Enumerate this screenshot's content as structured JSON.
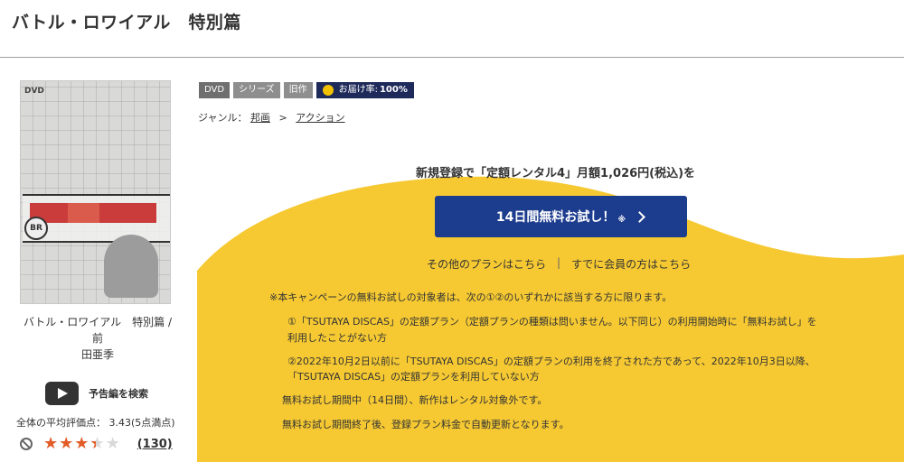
{
  "page": {
    "title": "バトル・ロワイアル　特別篇"
  },
  "item": {
    "cover_alt": "バトル・ロワイアル 特別篇 DVDジャケット",
    "caption_line1": "バトル・ロワイアル　特別篇 / 前",
    "caption_line2": "田亜季",
    "cover_mark": "DVD",
    "cover_badge": "BR"
  },
  "trailer": {
    "label": "予告編を検索",
    "icon": "youtube-play-icon"
  },
  "rating": {
    "average_text": "全体の平均評価点：  3.43(5点満点)",
    "value": 3.43,
    "max": 5,
    "review_count": "(130)",
    "star_color": "#e35b26"
  },
  "tags": {
    "format": "DVD",
    "series": "シリーズ",
    "old": "旧作",
    "delivery_label": "お届け率:",
    "delivery_rate": "100%"
  },
  "genre": {
    "label": "ジャンル：",
    "level1": "邦画",
    "sep": ">",
    "level2": "アクション"
  },
  "offer": {
    "intro": "新規登録で「定額レンタル4」月額1,026円(税込)を",
    "cta_label": "14日間無料お試し！",
    "cta_mark": "※",
    "other_plans": "その他のプランはこちら",
    "divider": "|",
    "members": "すでに会員の方はこちら",
    "accent_color": "#1c3c8e",
    "yellow_color": "#f6c932"
  },
  "notes": {
    "heading": "※本キャンペーンの無料お試しの対象者は、次の①②のいずれかに該当する方に限ります。",
    "c1_line1": "①「TSUTAYA DISCAS」の定額プラン（定額プランの種類は問いません。以下同じ）の利用開始時に「無料お試し」を",
    "c1_line2": "利用したことがない方",
    "c2_line1": "②2022年10月2日以前に「TSUTAYA DISCAS」の定額プランの利用を終了された方であって、2022年10月3日以降、",
    "c2_line2": "「TSUTAYA DISCAS」の定額プランを利用していない方",
    "trial_period": "無料お試し期間中（14日間）、新作はレンタル対象外です。",
    "auto_renew": "無料お試し期間終了後、登録プラン料金で自動更新となります。"
  }
}
